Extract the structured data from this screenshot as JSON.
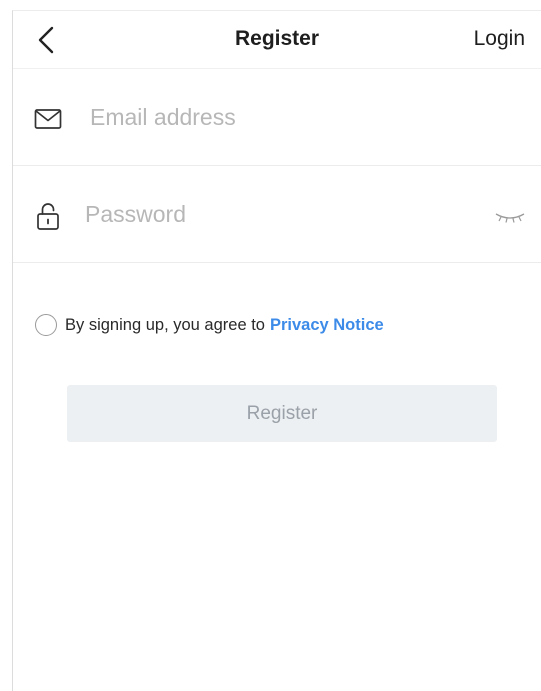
{
  "header": {
    "title": "Register",
    "login_label": "Login",
    "back_icon": "chevron-left-icon"
  },
  "form": {
    "email": {
      "icon": "envelope-icon",
      "placeholder": "Email address",
      "value": ""
    },
    "password": {
      "icon": "lock-icon",
      "placeholder": "Password",
      "value": "",
      "toggle_icon": "eye-closed-icon"
    },
    "agreement": {
      "checked": false,
      "text": "By signing up, you agree to",
      "link_label": "Privacy Notice"
    },
    "submit_label": "Register"
  },
  "colors": {
    "link": "#3d8be8",
    "button_bg": "#edf0f3",
    "button_text": "#9aa1a8",
    "placeholder": "#b7b7b7"
  }
}
